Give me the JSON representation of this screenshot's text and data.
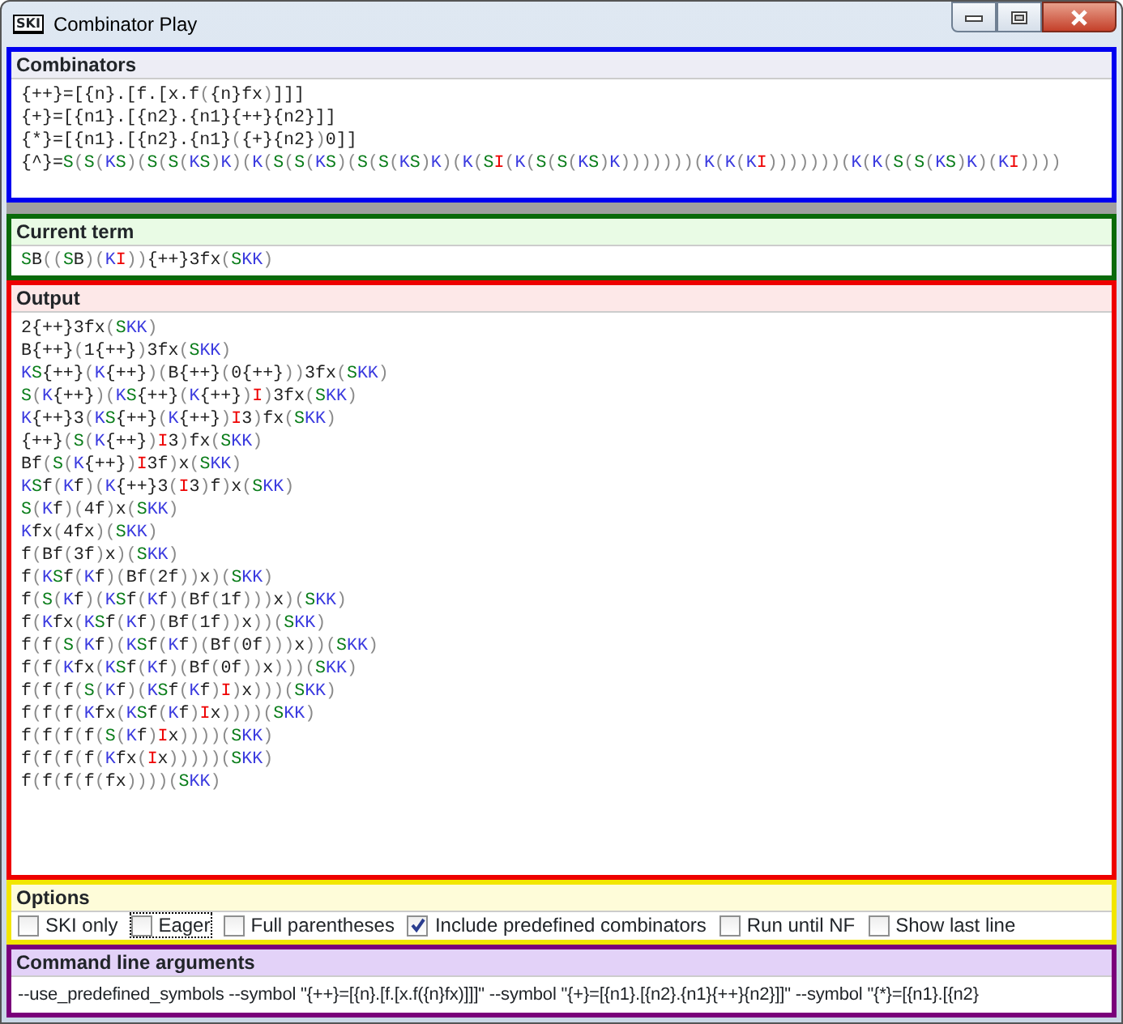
{
  "window": {
    "title": "Combinator Play",
    "icon_text": "SKI"
  },
  "combinators": {
    "title": "Combinators",
    "lines": [
      "{++}=[{n}.[f.[x.f({n}fx)]]]",
      "{+}=[{n1}.[{n2}.{n1}{++}{n2}]]",
      "{*}=[{n1}.[{n2}.{n1}({+}{n2})0]]",
      "{^}=S(S(KS)(S(S(KS)K)(K(S(S(KS)(S(S(KS)K)(K(SI(K(S(S(KS)K)))))))(K(K(KI)))))))(K(K(S(S(KS)K)(KI))))"
    ]
  },
  "current_term": {
    "title": "Current term",
    "value": "SB((SB)(KI)){++}3fx(SKK)"
  },
  "output": {
    "title": "Output",
    "lines": [
      "2{++}3fx(SKK)",
      "B{++}(1{++})3fx(SKK)",
      "KS{++}(K{++})(B{++}(0{++}))3fx(SKK)",
      "S(K{++})(KS{++}(K{++})I)3fx(SKK)",
      "K{++}3(KS{++}(K{++})I3)fx(SKK)",
      "{++}(S(K{++})I3)fx(SKK)",
      "Bf(S(K{++})I3f)x(SKK)",
      "KSf(Kf)(K{++}3(I3)f)x(SKK)",
      "S(Kf)(4f)x(SKK)",
      "Kfx(4fx)(SKK)",
      "f(Bf(3f)x)(SKK)",
      "f(KSf(Kf)(Bf(2f))x)(SKK)",
      "f(S(Kf)(KSf(Kf)(Bf(1f)))x)(SKK)",
      "f(Kfx(KSf(Kf)(Bf(1f))x))(SKK)",
      "f(f(S(Kf)(KSf(Kf)(Bf(0f)))x))(SKK)",
      "f(f(Kfx(KSf(Kf)(Bf(0f))x)))(SKK)",
      "f(f(f(S(Kf)(KSf(Kf)I)x)))(SKK)",
      "f(f(f(Kfx(KSf(Kf)Ix))))(SKK)",
      "f(f(f(f(S(Kf)Ix))))(SKK)",
      "f(f(f(f(Kfx(Ix)))))(SKK)",
      "f(f(f(f(fx))))(SKK)"
    ]
  },
  "options": {
    "title": "Options",
    "items": [
      {
        "label": "SKI only",
        "checked": false,
        "focused": false
      },
      {
        "label": "Eager",
        "checked": false,
        "focused": true
      },
      {
        "label": "Full parentheses",
        "checked": false,
        "focused": false
      },
      {
        "label": "Include predefined combinators",
        "checked": true,
        "focused": false
      },
      {
        "label": "Run until NF",
        "checked": false,
        "focused": false
      },
      {
        "label": "Show last line",
        "checked": false,
        "focused": false
      }
    ]
  },
  "command_line": {
    "title": "Command line arguments",
    "value": "--use_predefined_symbols --symbol \"{++}=[{n}.[f.[x.f({n}fx)]]]\" --symbol \"{+}=[{n1}.[{n2}.{n1}{++}{n2}]]\" --symbol \"{*}=[{n1}.[{n2}"
  }
}
